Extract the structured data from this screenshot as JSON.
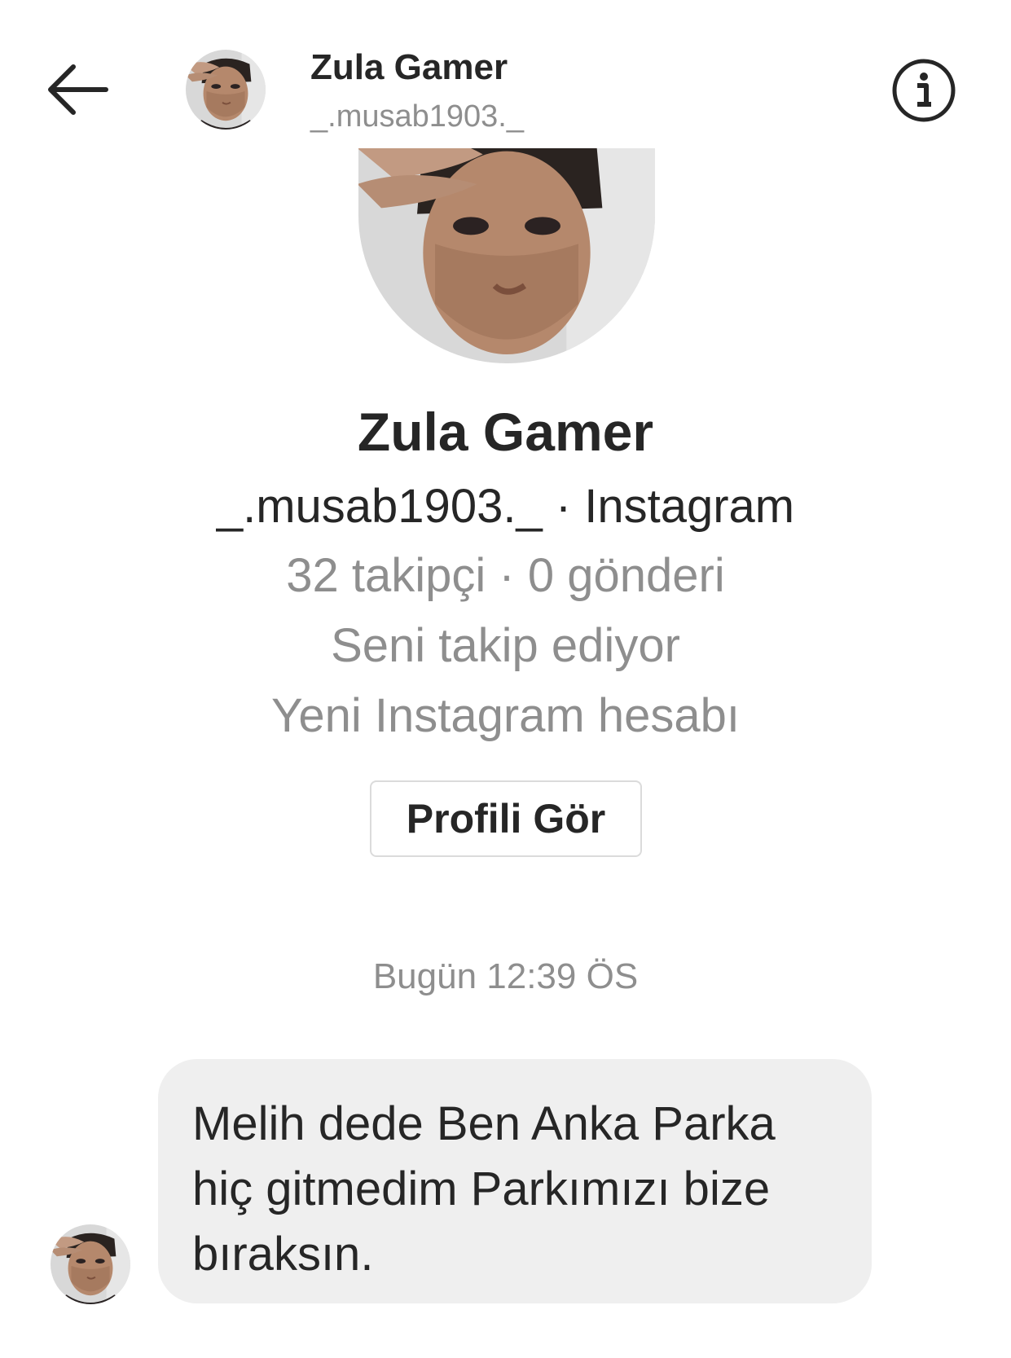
{
  "header": {
    "name": "Zula Gamer",
    "username": "_.musab1903._",
    "back_icon": "arrow-left-icon",
    "info_icon": "info-circle-icon"
  },
  "profile": {
    "name": "Zula Gamer",
    "line1": "_.musab1903._ · Instagram",
    "line2": "32 takipçi · 0 gönderi",
    "line3": "Seni takip ediyor",
    "line4": "Yeni Instagram hesabı",
    "button_label": "Profili Gör"
  },
  "conversation": {
    "timestamp": "Bugün 12:39 ÖS",
    "messages": [
      {
        "text": "Melih dede Ben Anka Parka\nhiç gitmedim Parkımızı bize\nbıraksın."
      }
    ]
  },
  "colors": {
    "text_primary": "#262626",
    "text_secondary": "#8e8e8e",
    "bubble_bg": "#efefef",
    "button_border": "#dbdbdb"
  }
}
